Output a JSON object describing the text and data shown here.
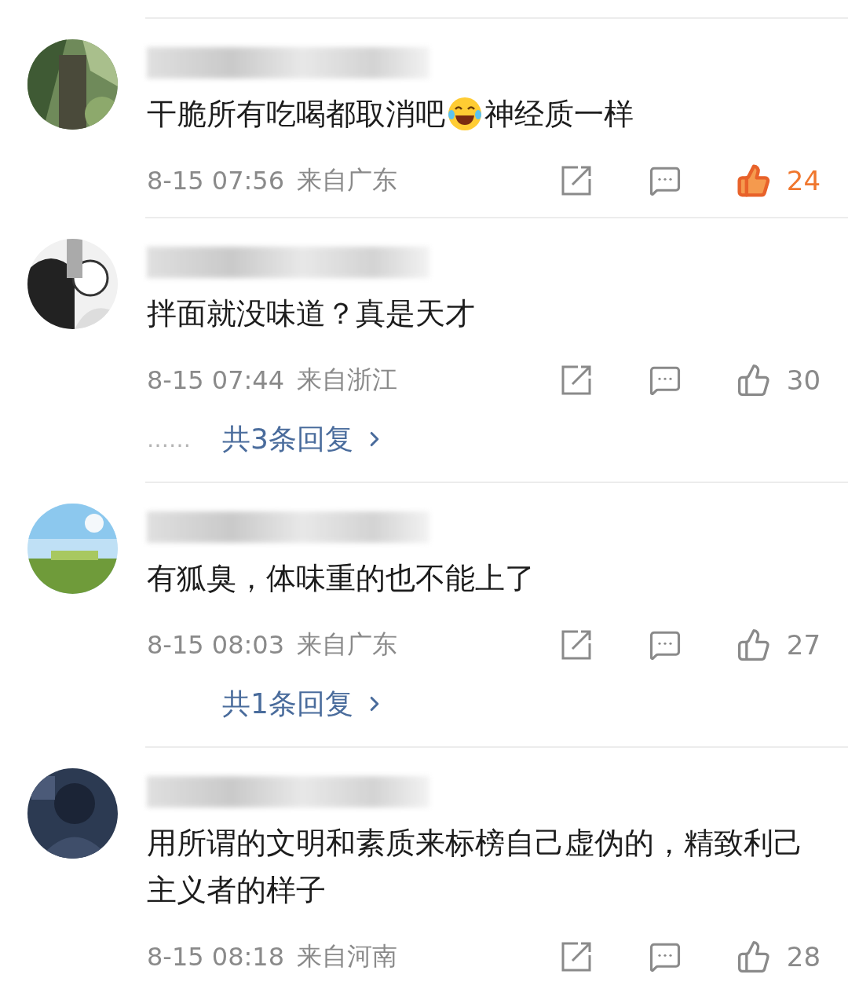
{
  "comments": [
    {
      "content": [
        {
          "kind": "text",
          "text": "干脆所有吃喝都取消吧"
        },
        {
          "kind": "emoji"
        },
        {
          "kind": "text",
          "text": "神经质一样"
        }
      ],
      "time": "8-15 07:56",
      "location": "来自广东",
      "likes": "24",
      "liked": true
    },
    {
      "content": [
        {
          "kind": "text",
          "text": "拌面就没味道？真是天才"
        }
      ],
      "time": "8-15 07:44",
      "location": "来自浙江",
      "likes": "30",
      "liked": false,
      "replies": {
        "dots": "……",
        "label": "共3条回复"
      }
    },
    {
      "content": [
        {
          "kind": "text",
          "text": "有狐臭，体味重的也不能上了"
        }
      ],
      "time": "8-15 08:03",
      "location": "来自广东",
      "likes": "27",
      "liked": false,
      "replies": {
        "label": "共1条回复"
      }
    },
    {
      "content": [
        {
          "kind": "text",
          "text": "用所谓的文明和素质来标榜自己虚伪的，精致利己主义者的样子"
        }
      ],
      "time": "8-15 08:18",
      "location": "来自河南",
      "likes": "28",
      "liked": false
    }
  ]
}
